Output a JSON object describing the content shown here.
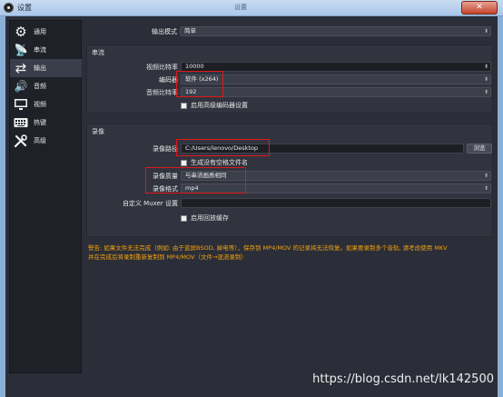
{
  "window": {
    "title": "设置",
    "center_title": "设置",
    "close_glyph": "✕"
  },
  "sidebar": {
    "items": [
      {
        "label": "通用",
        "icon": "gear-icon",
        "glyph": "⚙"
      },
      {
        "label": "串流",
        "icon": "antenna-icon",
        "glyph": "📡"
      },
      {
        "label": "输出",
        "icon": "output-icon",
        "glyph": "⇄",
        "active": true
      },
      {
        "label": "音频",
        "icon": "speaker-icon",
        "glyph": "🔊"
      },
      {
        "label": "视频",
        "icon": "monitor-icon",
        "glyph": "🖥"
      },
      {
        "label": "热键",
        "icon": "keyboard-icon",
        "glyph": "⌨"
      },
      {
        "label": "高级",
        "icon": "tools-icon",
        "glyph": "✂"
      }
    ]
  },
  "output_mode": {
    "label": "输出模式",
    "value": "简单"
  },
  "streaming": {
    "title": "串流",
    "video_bitrate_label": "视频比特率",
    "video_bitrate_value": "10000",
    "encoder_label": "编码器",
    "encoder_value": "软件 (x264)",
    "audio_bitrate_label": "音频比特率",
    "audio_bitrate_value": "192",
    "advanced_encoder_label": "启用高级编码器设置"
  },
  "recording": {
    "title": "录像",
    "path_label": "录像路径",
    "path_value": "C:/Users/lenovo/Desktop",
    "browse_label": "浏览",
    "no_space_label": "生成没有空格文件名",
    "quality_label": "录像质量",
    "quality_value": "与串流画质相同",
    "format_label": "录像格式",
    "format_value": "mp4",
    "muxer_label": "自定义 Muxer 设置",
    "muxer_value": "",
    "replay_buffer_label": "启用回放缓存"
  },
  "warning": {
    "line1": "警告: 如果文件无法完成（例如: 由于蓝屏BSOD, 掉电等），保存到 MP4/MOV 的记录将无法恢复。如果要录制多个音轨, 请考虑使用 MKV",
    "line2": "并在完成后将录制重新复制到 MP4/MOV（文件→混流录制）"
  },
  "watermark": "https://blog.csdn.net/lk142500",
  "colors": {
    "warning": "#f2a10c",
    "highlight": "#e01818",
    "background": "#2b2e38"
  }
}
